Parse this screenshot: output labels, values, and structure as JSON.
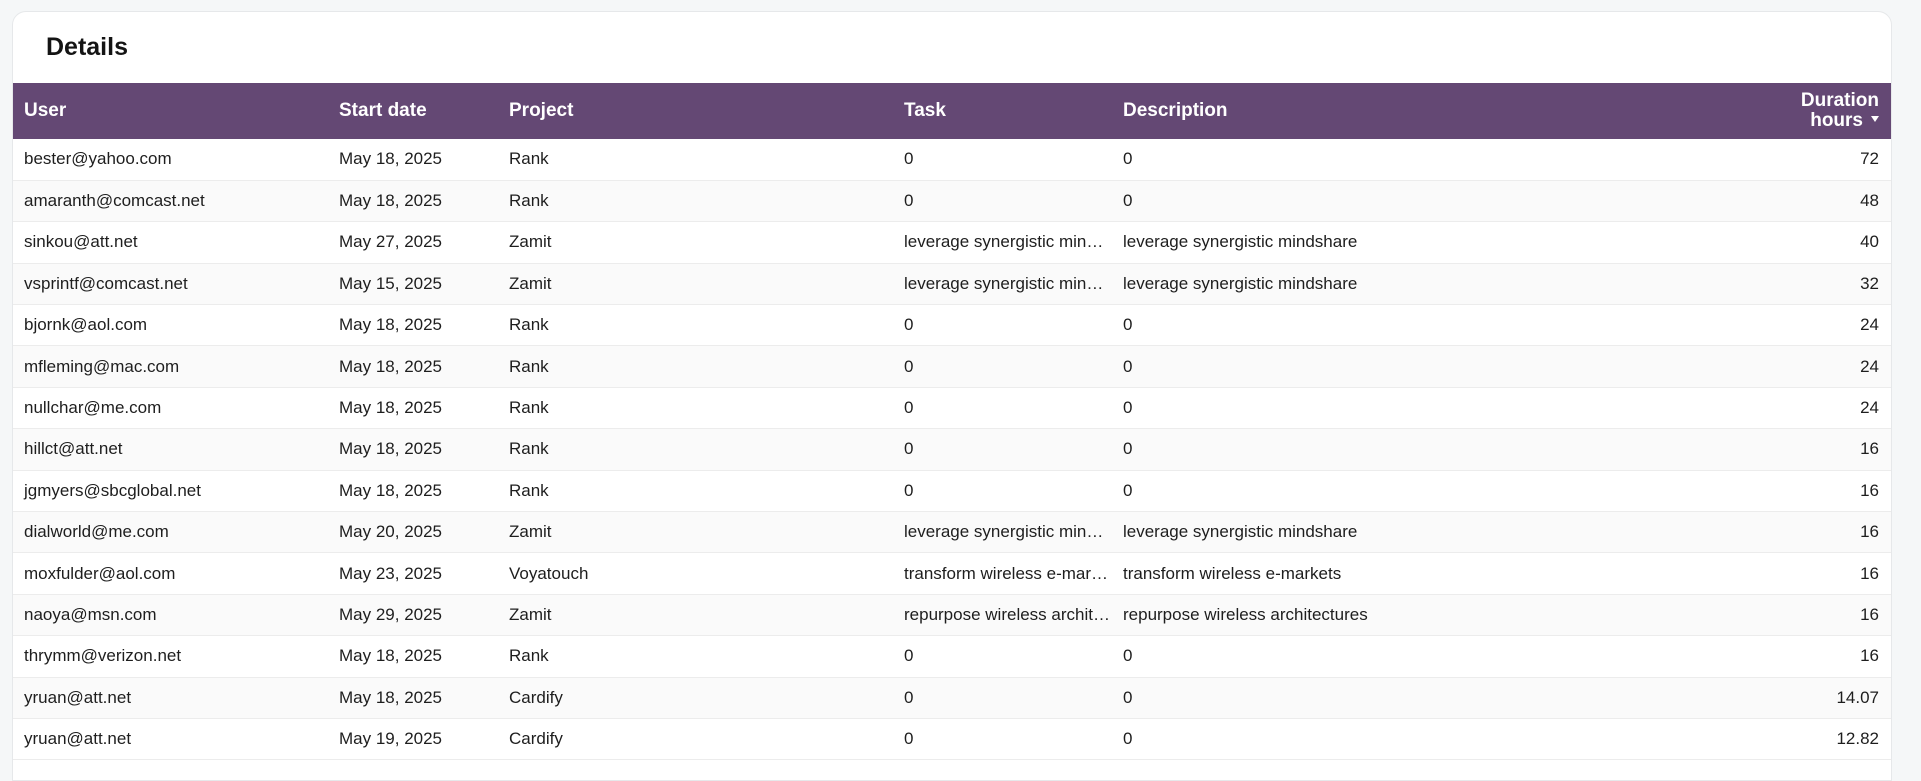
{
  "section": {
    "title": "Details"
  },
  "table": {
    "headers": {
      "user": "User",
      "start_date": "Start date",
      "project": "Project",
      "task": "Task",
      "description": "Description",
      "duration_line1": "Duration",
      "duration_line2": "hours"
    },
    "sort": {
      "column": "Duration hours",
      "direction": "descending"
    },
    "rows": [
      {
        "user": "bester@yahoo.com",
        "start_date": "May 18, 2025",
        "project": "Rank",
        "task": "0",
        "description": "0",
        "duration": "72"
      },
      {
        "user": "amaranth@comcast.net",
        "start_date": "May 18, 2025",
        "project": "Rank",
        "task": "0",
        "description": "0",
        "duration": "48"
      },
      {
        "user": "sinkou@att.net",
        "start_date": "May 27, 2025",
        "project": "Zamit",
        "task": "leverage synergistic mindshare",
        "description": "leverage synergistic mindshare",
        "duration": "40"
      },
      {
        "user": "vsprintf@comcast.net",
        "start_date": "May 15, 2025",
        "project": "Zamit",
        "task": "leverage synergistic mindshare",
        "description": "leverage synergistic mindshare",
        "duration": "32"
      },
      {
        "user": "bjornk@aol.com",
        "start_date": "May 18, 2025",
        "project": "Rank",
        "task": "0",
        "description": "0",
        "duration": "24"
      },
      {
        "user": "mfleming@mac.com",
        "start_date": "May 18, 2025",
        "project": "Rank",
        "task": "0",
        "description": "0",
        "duration": "24"
      },
      {
        "user": "nullchar@me.com",
        "start_date": "May 18, 2025",
        "project": "Rank",
        "task": "0",
        "description": "0",
        "duration": "24"
      },
      {
        "user": "hillct@att.net",
        "start_date": "May 18, 2025",
        "project": "Rank",
        "task": "0",
        "description": "0",
        "duration": "16"
      },
      {
        "user": "jgmyers@sbcglobal.net",
        "start_date": "May 18, 2025",
        "project": "Rank",
        "task": "0",
        "description": "0",
        "duration": "16"
      },
      {
        "user": "dialworld@me.com",
        "start_date": "May 20, 2025",
        "project": "Zamit",
        "task": "leverage synergistic mindshare",
        "description": "leverage synergistic mindshare",
        "duration": "16"
      },
      {
        "user": "moxfulder@aol.com",
        "start_date": "May 23, 2025",
        "project": "Voyatouch",
        "task": "transform wireless e-markets",
        "description": "transform wireless e-markets",
        "duration": "16"
      },
      {
        "user": "naoya@msn.com",
        "start_date": "May 29, 2025",
        "project": "Zamit",
        "task": "repurpose wireless architectures",
        "description": "repurpose wireless architectures",
        "duration": "16"
      },
      {
        "user": "thrymm@verizon.net",
        "start_date": "May 18, 2025",
        "project": "Rank",
        "task": "0",
        "description": "0",
        "duration": "16"
      },
      {
        "user": "yruan@att.net",
        "start_date": "May 18, 2025",
        "project": "Cardify",
        "task": "0",
        "description": "0",
        "duration": "14.07"
      },
      {
        "user": "yruan@att.net",
        "start_date": "May 19, 2025",
        "project": "Cardify",
        "task": "0",
        "description": "0",
        "duration": "12.82"
      }
    ]
  },
  "colors": {
    "header_bg": "#644874",
    "header_text": "#ffffff",
    "card_bg": "#ffffff",
    "page_bg": "#f5f7f8"
  },
  "icons": {
    "sort_indicator": "caret-down-icon"
  }
}
